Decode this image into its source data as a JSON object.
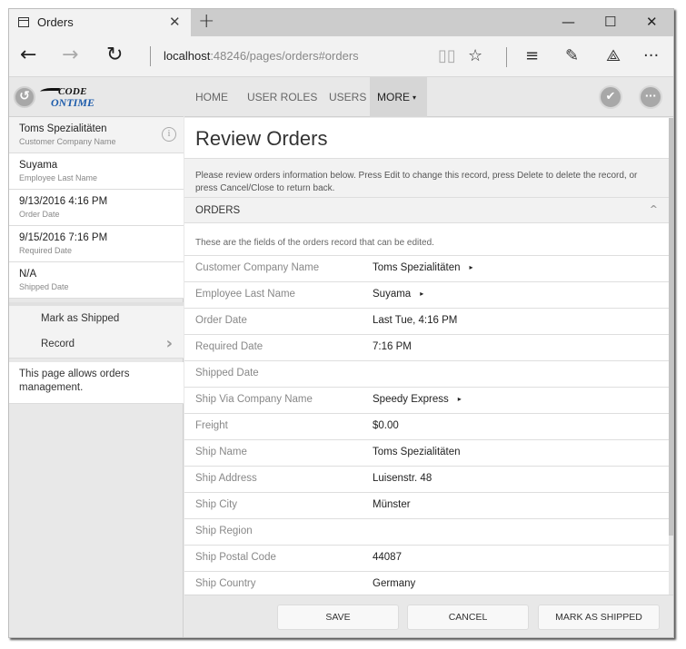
{
  "browser": {
    "tab_title": "Orders",
    "tab_icon": "page-icon",
    "address_host": "localhost",
    "address_rest": ":48246/pages/orders#orders",
    "icons": {
      "back": "←",
      "forward": "→",
      "refresh": "↻",
      "reading_view": "📖",
      "favorite": "☆",
      "hub": "≡",
      "web_note": "✎",
      "share": "⟁",
      "more": "···",
      "close_tab": "✕",
      "new_tab": "+",
      "minimize": "—",
      "maximize": "☐",
      "close_window": "✕"
    }
  },
  "app": {
    "logo": {
      "top": "CODE",
      "bottom": "ONTIME"
    },
    "back_icon": "↺",
    "menu": [
      {
        "label": "HOME"
      },
      {
        "label": "USER ROLES"
      },
      {
        "label": "USERS"
      },
      {
        "label": "MORE",
        "caret": "▾"
      }
    ],
    "toolbar_icons": {
      "confirm": "✔",
      "more": "···"
    }
  },
  "sidebar": {
    "summary": [
      {
        "value": "Toms Spezialitäten",
        "label": "Customer Company Name",
        "info_icon": "i"
      },
      {
        "value": "Suyama",
        "label": "Employee Last Name"
      },
      {
        "value": "9/13/2016 4:16 PM",
        "label": "Order Date"
      },
      {
        "value": "9/15/2016 7:16 PM",
        "label": "Required Date"
      },
      {
        "value": "N/A",
        "label": "Shipped Date"
      }
    ],
    "actions": [
      {
        "label": "Mark as Shipped"
      },
      {
        "label": "Record",
        "chevron": "›"
      }
    ],
    "note": "This page allows orders management."
  },
  "main": {
    "title": "Review Orders",
    "description": "Please review orders information below. Press Edit to change this record, press Delete to delete the record, or press Cancel/Close to return back.",
    "category": {
      "title": "ORDERS",
      "collapse_icon": "^",
      "description": "These are the fields of the orders record that can be edited."
    },
    "fields": [
      {
        "label": "Customer Company Name",
        "value": "Toms Spezialitäten",
        "lookup": "▸"
      },
      {
        "label": "Employee Last Name",
        "value": "Suyama",
        "lookup": "▸"
      },
      {
        "label": "Order Date",
        "value": "Last Tue, 4:16 PM"
      },
      {
        "label": "Required Date",
        "value": "7:16 PM"
      },
      {
        "label": "Shipped Date",
        "value": ""
      },
      {
        "label": "Ship Via Company Name",
        "value": "Speedy Express",
        "lookup": "▸"
      },
      {
        "label": "Freight",
        "value": "$0.00"
      },
      {
        "label": "Ship Name",
        "value": "Toms Spezialitäten"
      },
      {
        "label": "Ship Address",
        "value": "Luisenstr. 48"
      },
      {
        "label": "Ship City",
        "value": "Münster"
      },
      {
        "label": "Ship Region",
        "value": ""
      },
      {
        "label": "Ship Postal Code",
        "value": "44087"
      },
      {
        "label": "Ship Country",
        "value": "Germany"
      }
    ],
    "buttons": {
      "save": "SAVE",
      "cancel": "CANCEL",
      "mark_shipped": "MARK AS SHIPPED"
    }
  }
}
